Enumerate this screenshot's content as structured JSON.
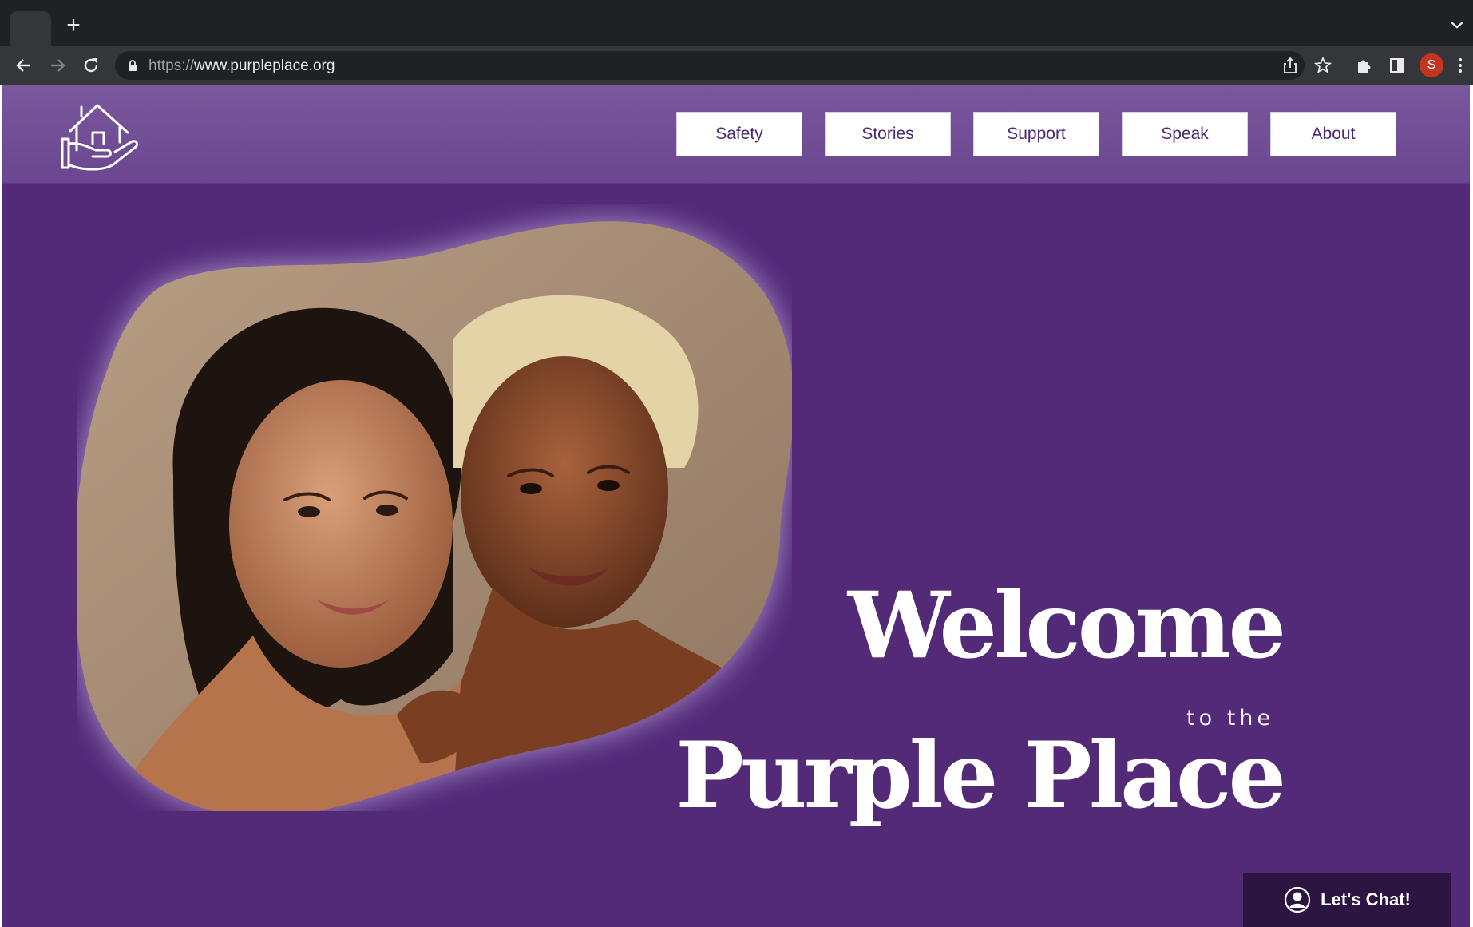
{
  "browser": {
    "new_tab_label": "+",
    "url_scheme": "https://",
    "url_host": "www.purpleplace.org",
    "profile_initial": "S",
    "icons": [
      "back-icon",
      "forward-icon",
      "reload-icon",
      "lock-icon",
      "share-icon",
      "bookmark-star-icon",
      "extensions-icon",
      "side-panel-icon",
      "kebab-menu-icon",
      "tab-list-chevron-icon"
    ]
  },
  "site": {
    "logo_icon": "house-in-hand-icon",
    "nav": [
      {
        "label": "Safety"
      },
      {
        "label": "Stories"
      },
      {
        "label": "Support"
      },
      {
        "label": "Speak"
      },
      {
        "label": "About"
      }
    ]
  },
  "hero": {
    "welcome": "Welcome",
    "to_the": "to the",
    "title": "Purple Place",
    "photo_alt": "Two women posing together"
  },
  "chat": {
    "label": "Let's Chat!",
    "icon": "user-circle-icon"
  },
  "colors": {
    "page_bg": "#522a78",
    "header_bg": "#7a589c",
    "chat_bg": "#2c1540",
    "nav_text": "#4a2a70"
  }
}
